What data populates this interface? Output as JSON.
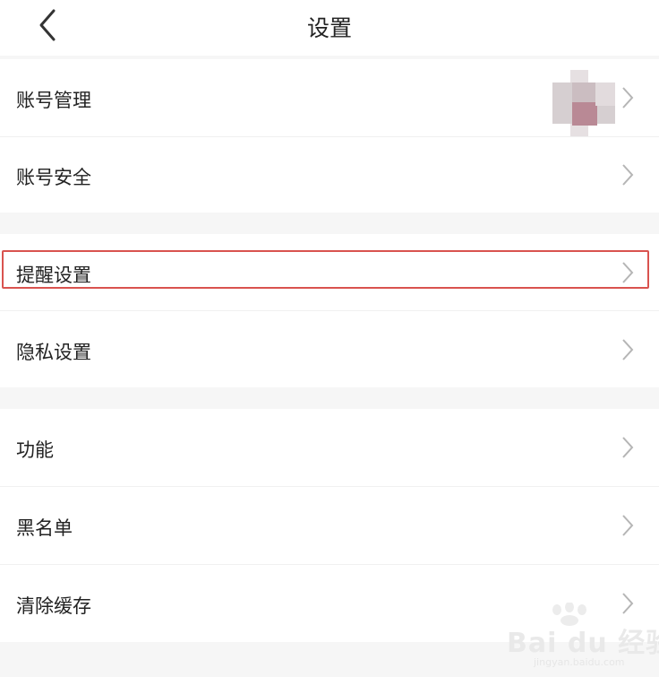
{
  "header": {
    "title": "设置",
    "back_icon": "chevron-left-icon"
  },
  "settings": {
    "account_management": "账号管理",
    "account_security": "账号安全",
    "notification_settings": "提醒设置",
    "privacy_settings": "隐私设置",
    "features": "功能",
    "blacklist": "黑名单",
    "clear_cache": "清除缓存"
  },
  "avatar": {
    "icon": "avatar-pixelated",
    "colors": [
      "#c9bfc2",
      "#b98a95",
      "#e0d8da"
    ]
  },
  "highlight": {
    "color": "#d9534f"
  },
  "watermark": {
    "text": "Bai du 经验",
    "url": "jingyan.baidu.com"
  }
}
